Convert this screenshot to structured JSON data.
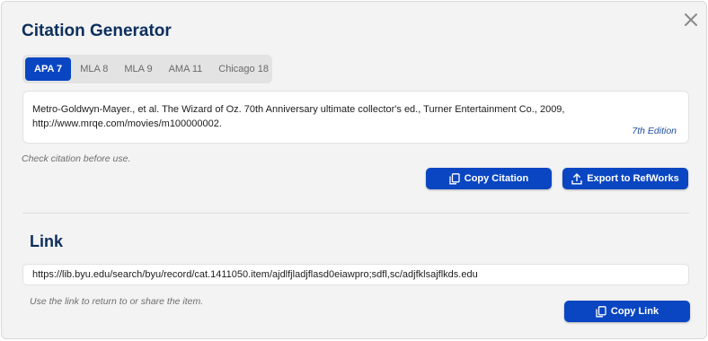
{
  "dialog": {
    "title": "Citation Generator",
    "close_icon": "close-icon"
  },
  "tabs": [
    {
      "label": "APA 7",
      "active": true
    },
    {
      "label": "MLA 8",
      "active": false
    },
    {
      "label": "MLA 9",
      "active": false
    },
    {
      "label": "AMA 11",
      "active": false
    },
    {
      "label": "Chicago 18",
      "active": false
    }
  ],
  "citation": {
    "text": "Metro-Goldwyn-Mayer., et al. The Wizard of Oz. 70th Anniversary ultimate collector's ed., Turner Entertainment Co., 2009, http://www.mrqe.com/movies/m100000002.",
    "edition": "7th Edition",
    "hint": "Check citation before use.",
    "copy_label": "Copy Citation",
    "export_label": "Export to RefWorks"
  },
  "link": {
    "title": "Link",
    "url": "https://lib.byu.edu/search/byu/record/cat.1411050.item/ajdlfjladjflasd0eiawpro;sdfl,sc/adjfklsajflkds.edu",
    "hint": "Use the link to return to or share the item.",
    "copy_label": "Copy Link"
  },
  "colors": {
    "accent": "#0a46c2",
    "heading": "#0b2f5c",
    "background": "#f3f3f3"
  }
}
